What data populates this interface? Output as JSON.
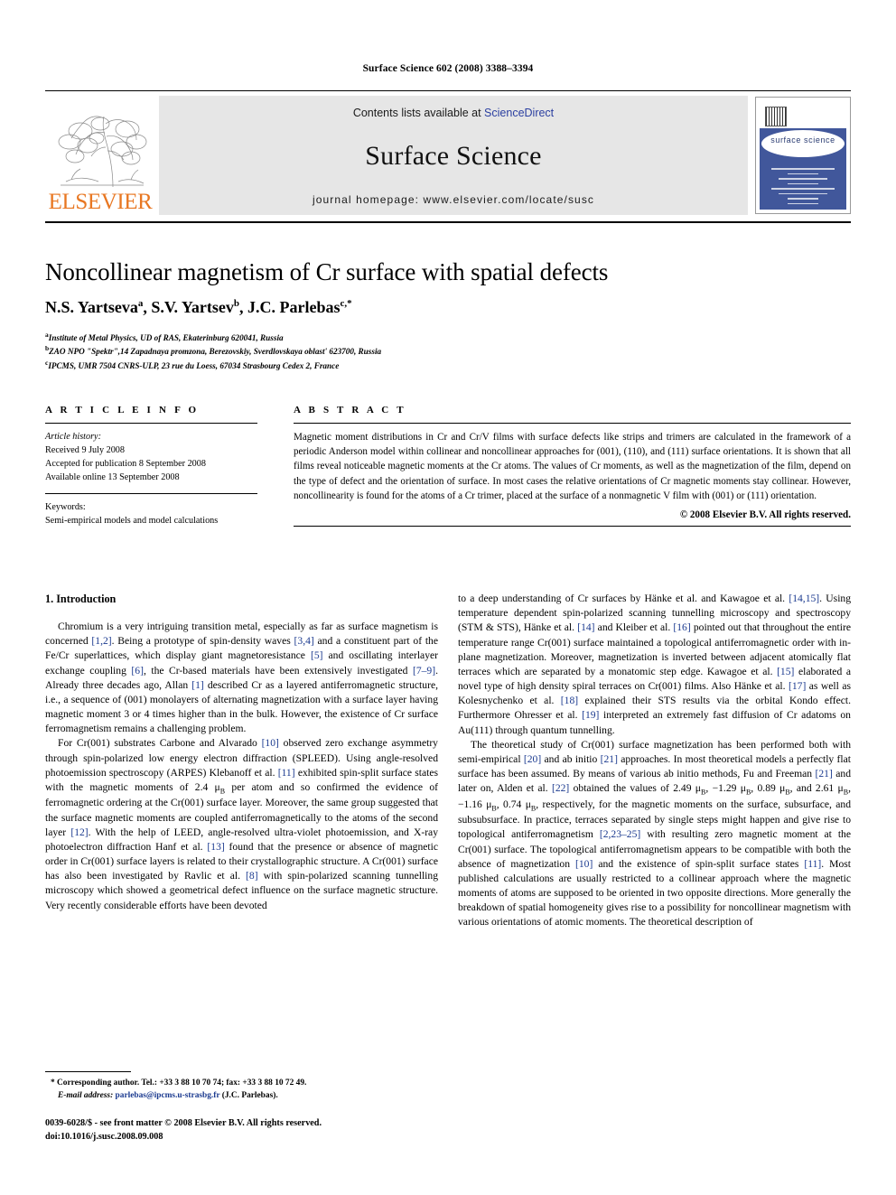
{
  "running_head": "Surface Science 602 (2008) 3388–3394",
  "masthead": {
    "contents_prefix": "Contents lists available at ",
    "sciencedirect": "ScienceDirect",
    "journal_name": "Surface Science",
    "homepage": "journal homepage: www.elsevier.com/locate/susc",
    "publisher_logo_text": "ELSEVIER",
    "cover_title": "surface science",
    "link_color": "#2b3fa0",
    "brand_color": "#E87722"
  },
  "article": {
    "title": "Noncollinear magnetism of Cr surface with spatial defects",
    "authors": [
      {
        "name": "N.S. Yartseva",
        "sup": "a"
      },
      {
        "name": "S.V. Yartsev",
        "sup": "b"
      },
      {
        "name": "J.C. Parlebas",
        "sup": "c,*"
      }
    ],
    "authors_line": "N.S. Yartseva a, S.V. Yartsev b, J.C. Parlebas c,*",
    "affiliations": [
      {
        "sup": "a",
        "text": "Institute of Metal Physics, UD of RAS, Ekaterinburg 620041, Russia"
      },
      {
        "sup": "b",
        "text": "ZAO NPO \"Spektr\",14 Zapadnaya promzona, Berezovskiy, Sverdlovskaya oblast' 623700, Russia"
      },
      {
        "sup": "c",
        "text": "IPCMS, UMR 7504 CNRS-ULP, 23 rue du Loess, 67034 Strasbourg Cedex 2, France"
      }
    ]
  },
  "article_info": {
    "heading": "A R T I C L E   I N F O",
    "history_label": "Article history:",
    "received": "Received 9 July 2008",
    "accepted": "Accepted for publication 8 September 2008",
    "available": "Available online 13 September 2008",
    "keywords_label": "Keywords:",
    "keywords": "Semi-empirical models and model calculations"
  },
  "abstract": {
    "heading": "A B S T R A C T",
    "text": "Magnetic moment distributions in Cr and Cr/V films with surface defects like strips and trimers are calculated in the framework of a periodic Anderson model within collinear and noncollinear approaches for (001), (110), and (111) surface orientations. It is shown that all films reveal noticeable magnetic moments at the Cr atoms. The values of Cr moments, as well as the magnetization of the film, depend on the type of defect and the orientation of surface. In most cases the relative orientations of Cr magnetic moments stay collinear. However, noncollinearity is found for the atoms of a Cr trimer, placed at the surface of a nonmagnetic V film with (001) or (111) orientation.",
    "copyright": "© 2008 Elsevier B.V. All rights reserved."
  },
  "body": {
    "section_heading": "1. Introduction",
    "left_paragraphs": [
      "Chromium is a very intriguing transition metal, especially as far as surface magnetism is concerned [1,2]. Being a prototype of spin-density waves [3,4] and a constituent part of the Fe/Cr superlattices, which display giant magnetoresistance [5] and oscillating interlayer exchange coupling [6], the Cr-based materials have been extensively investigated [7–9]. Already three decades ago, Allan [1] described Cr as a layered antiferromagnetic structure, i.e., a sequence of (001) monolayers of alternating magnetization with a surface layer having magnetic moment 3 or 4 times higher than in the bulk. However, the existence of Cr surface ferromagnetism remains a challenging problem.",
      "For Cr(001) substrates Carbone and Alvarado [10] observed zero exchange asymmetry through spin-polarized low energy electron diffraction (SPLEED). Using angle-resolved photoemission spectroscopy (ARPES) Klebanoff et al. [11] exhibited spin-split surface states with the magnetic moments of 2.4 μB per atom and so confirmed the evidence of ferromagnetic ordering at the Cr(001) surface layer. Moreover, the same group suggested that the surface magnetic moments are coupled antiferromagnetically to the atoms of the second layer [12]. With the help of LEED, angle-resolved ultra-violet photoemission, and X-ray photoelectron diffraction Hanf et al. [13] found that the presence or absence of magnetic order in Cr(001) surface layers is related to their crystallographic structure. A Cr(001) surface has also been investigated by Ravlic et al. [8] with spin-polarized scanning tunnelling microscopy which showed a geometrical defect influence on the surface magnetic structure. Very recently considerable efforts have been devoted"
    ],
    "right_paragraphs": [
      "to a deep understanding of Cr surfaces by Hänke et al. and Kawagoe et al. [14,15]. Using temperature dependent spin-polarized scanning tunnelling microscopy and spectroscopy (STM & STS), Hänke et al. [14] and Kleiber et al. [16] pointed out that throughout the entire temperature range Cr(001) surface maintained a topological antiferromagnetic order with in-plane magnetization. Moreover, magnetization is inverted between adjacent atomically flat terraces which are separated by a monatomic step edge. Kawagoe et al. [15] elaborated a novel type of high density spiral terraces on Cr(001) films. Also Hänke et al. [17] as well as Kolesnychenko et al. [18] explained their STS results via the orbital Kondo effect. Furthermore Ohresser et al. [19] interpreted an extremely fast diffusion of Cr adatoms on Au(111) through quantum tunnelling.",
      "The theoretical study of Cr(001) surface magnetization has been performed both with semi-empirical [20] and ab initio [21] approaches. In most theoretical models a perfectly flat surface has been assumed. By means of various ab initio methods, Fu and Freeman [21] and later on, Alden et al. [22] obtained the values of 2.49 μB, −1.29 μB, 0.89 μB, and 2.61 μB, −1.16 μB, 0.74 μB, respectively, for the magnetic moments on the surface, subsurface, and subsubsurface. In practice, terraces separated by single steps might happen and give rise to topological antiferromagnetism [2,23–25] with resulting zero magnetic moment at the Cr(001) surface. The topological antiferromagnetism appears to be compatible with both the absence of magnetization [10] and the existence of spin-split surface states [11]. Most published calculations are usually restricted to a collinear approach where the magnetic moments of atoms are supposed to be oriented in two opposite directions. More generally the breakdown of spatial homogeneity gives rise to a possibility for noncollinear magnetism with various orientations of atomic moments. The theoretical description of"
    ]
  },
  "footnote": {
    "corresponding": "* Corresponding author. Tel.: +33 3 88 10 70 74; fax: +33 3 88 10 72 49.",
    "email_label": "E-mail address:",
    "email": "parlebas@ipcms.u-strasbg.fr",
    "email_owner": "(J.C. Parlebas)."
  },
  "footer": {
    "issn_line": "0039-6028/$ - see front matter © 2008 Elsevier B.V. All rights reserved.",
    "doi_line": "doi:10.1016/j.susc.2008.09.008"
  }
}
